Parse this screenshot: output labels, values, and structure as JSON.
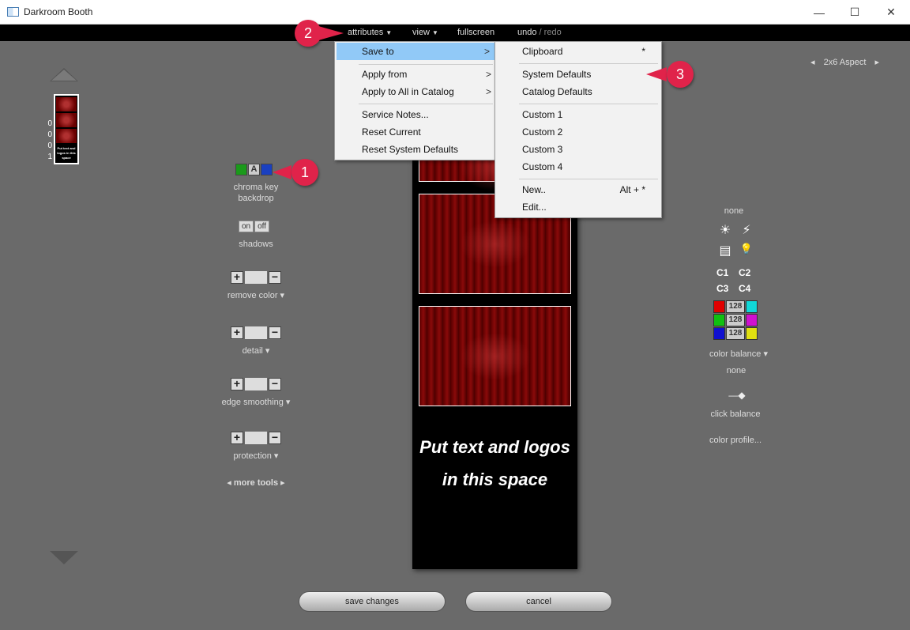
{
  "window": {
    "title": "Darkroom Booth",
    "minimize": "—",
    "maximize": "☐",
    "close": "✕"
  },
  "menubar": {
    "attributes": "attributes",
    "view": "view",
    "fullscreen": "fullscreen",
    "undo": "undo",
    "slash": "/",
    "redo": "redo",
    "caret": "▼"
  },
  "main_menu": {
    "items": [
      {
        "label": "Save to",
        "arrow": ">"
      },
      {
        "label": "Apply from",
        "arrow": ">"
      },
      {
        "label": "Apply to All in Catalog",
        "arrow": ">"
      },
      {
        "label": "Service Notes..."
      },
      {
        "label": "Reset Current"
      },
      {
        "label": "Reset System Defaults"
      }
    ]
  },
  "submenu": {
    "items": [
      {
        "label": "Clipboard",
        "shortcut": "*"
      },
      {
        "label": "System Defaults"
      },
      {
        "label": "Catalog Defaults"
      },
      {
        "label": "Custom 1"
      },
      {
        "label": "Custom 2"
      },
      {
        "label": "Custom 3"
      },
      {
        "label": "Custom 4"
      },
      {
        "label": "New..",
        "shortcut": "Alt + *"
      },
      {
        "label": "Edit..."
      }
    ]
  },
  "thumb": {
    "numbers": [
      "0",
      "0",
      "0",
      "1"
    ],
    "text": "Put text and logos in this space"
  },
  "left_tools": {
    "chroma_a": "A",
    "chroma_label_1": "chroma key",
    "chroma_label_2": "backdrop",
    "on": "on",
    "off": "off",
    "shadows": "shadows",
    "plus": "+",
    "minus": "−",
    "remove_color": "remove color ▾",
    "detail": "detail ▾",
    "edge_smoothing": "edge smoothing ▾",
    "protection": "protection ▾",
    "more_tools": "◂ more tools ▸"
  },
  "strip": {
    "text": "Put text and logos in this space"
  },
  "aspect": {
    "prev": "◂",
    "label": "2x6  Aspect",
    "next": "▸"
  },
  "right_panel": {
    "none_top": "none",
    "c1": "C1",
    "c2": "C2",
    "c3": "C3",
    "c4": "C4",
    "val_r": "128",
    "val_g": "128",
    "val_b": "128",
    "color_balance": "color balance ▾",
    "none_mid": "none",
    "click_balance": "click balance",
    "color_profile": "color profile..."
  },
  "icons": {
    "sun": "☀",
    "flash": "⚡",
    "fluorescent": "▤",
    "bulb": "💡",
    "dropper": "—◆"
  },
  "buttons": {
    "save": "save changes",
    "cancel": "cancel"
  },
  "callouts": {
    "one": "1",
    "two": "2",
    "three": "3"
  },
  "colors": {
    "callout": "#e0234a",
    "menu_highlight": "#91c9f7",
    "chroma_green": "#1a9a1a",
    "chroma_blue": "#1a40c0",
    "red": "#e00000",
    "green": "#10c010",
    "blue": "#1010d0",
    "cyan": "#10d8d8",
    "magenta": "#d010d0",
    "yellow": "#e0e010"
  }
}
